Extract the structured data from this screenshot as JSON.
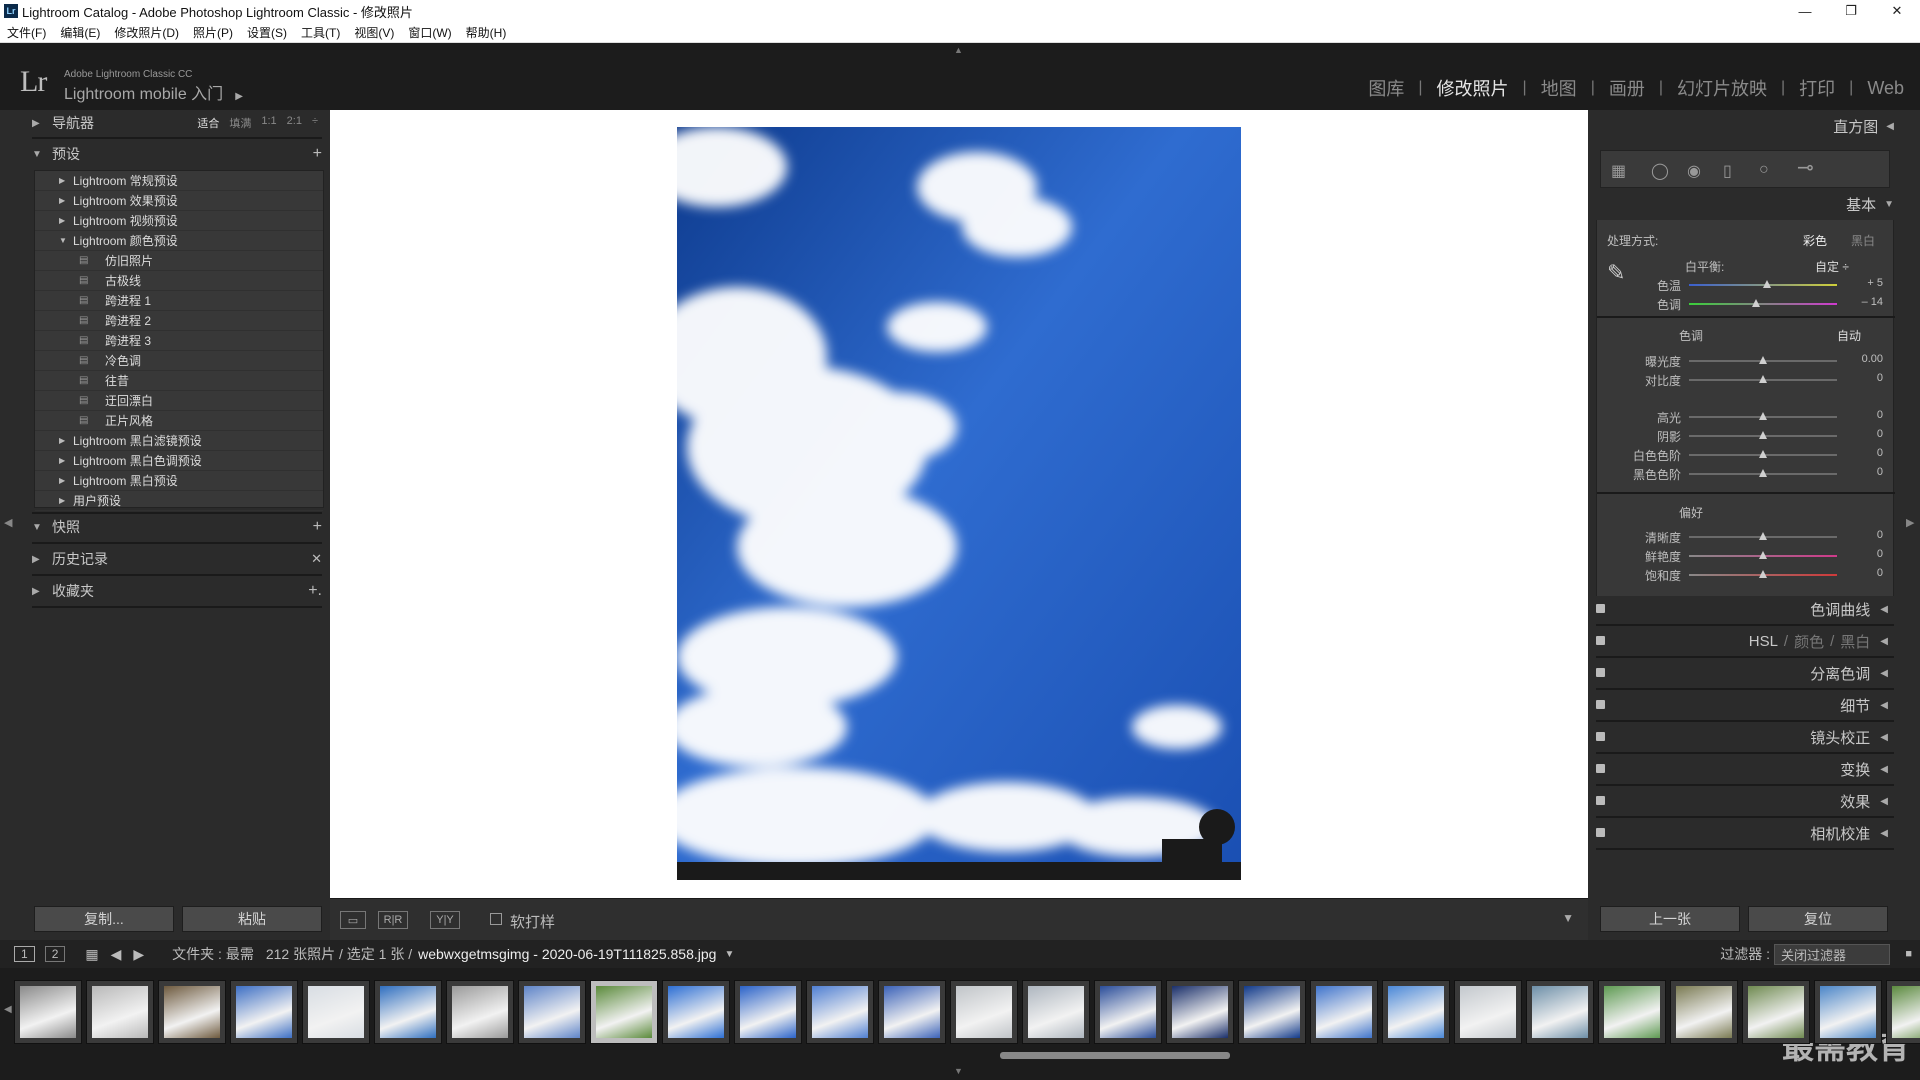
{
  "titlebar": {
    "badge": "Lr",
    "title": "Lightroom Catalog - Adobe Photoshop Lightroom Classic - 修改照片",
    "minimize": "—",
    "restore": "❐",
    "close": "✕"
  },
  "menu": [
    "文件(F)",
    "编辑(E)",
    "修改照片(D)",
    "照片(P)",
    "设置(S)",
    "工具(T)",
    "视图(V)",
    "窗口(W)",
    "帮助(H)"
  ],
  "identity": {
    "logo": "Lr",
    "small": "Adobe Lightroom Classic CC",
    "big": "Lightroom mobile 入门",
    "play": "▶"
  },
  "modules": [
    "图库",
    "修改照片",
    "地图",
    "画册",
    "幻灯片放映",
    "打印",
    "Web"
  ],
  "active_module": "修改照片",
  "left_panel": {
    "navigator": {
      "title": "导航器",
      "zoom": [
        "适合",
        "填满",
        "1:1",
        "2:1"
      ],
      "zoom_active": "适合"
    },
    "presets": {
      "title": "预设",
      "add": "+",
      "items": [
        {
          "label": "Lightroom 常规预设",
          "type": "group"
        },
        {
          "label": "Lightroom 效果预设",
          "type": "group"
        },
        {
          "label": "Lightroom 视频预设",
          "type": "group"
        },
        {
          "label": "Lightroom 颜色预设",
          "type": "open"
        },
        {
          "label": "仿旧照片",
          "type": "child"
        },
        {
          "label": "古极线",
          "type": "child"
        },
        {
          "label": "跨进程 1",
          "type": "child"
        },
        {
          "label": "跨进程 2",
          "type": "child"
        },
        {
          "label": "跨进程 3",
          "type": "child"
        },
        {
          "label": "冷色调",
          "type": "child"
        },
        {
          "label": "往昔",
          "type": "child"
        },
        {
          "label": "迂回漂白",
          "type": "child"
        },
        {
          "label": "正片风格",
          "type": "child"
        },
        {
          "label": "Lightroom 黑白滤镜预设",
          "type": "group"
        },
        {
          "label": "Lightroom 黑白色调预设",
          "type": "group"
        },
        {
          "label": "Lightroom 黑白预设",
          "type": "group"
        },
        {
          "label": "用户预设",
          "type": "group"
        }
      ]
    },
    "snapshots": {
      "title": "快照",
      "add": "+"
    },
    "history": {
      "title": "历史记录",
      "clear": "✕"
    },
    "collections": {
      "title": "收藏夹",
      "add": "+."
    },
    "copy_button": "复制...",
    "paste_button": "粘贴"
  },
  "toolbar": {
    "ab1": "R|R",
    "ab2": "Y|Y",
    "soft_proof": "软打样"
  },
  "right_panel": {
    "histogram": "直方图",
    "basic": "基本",
    "treatment_label": "处理方式:",
    "treatment_color": "彩色",
    "treatment_bw": "黑白",
    "wb_label": "白平衡:",
    "wb_value": "自定 ÷",
    "tone_label": "色调",
    "tone_auto": "自动",
    "presence_label": "偏好",
    "sliders_wb": [
      {
        "label": "色温",
        "value": "+ 5",
        "pos": 0.53
      },
      {
        "label": "色调",
        "value": "– 14",
        "pos": 0.45
      }
    ],
    "sliders_tone1": [
      {
        "label": "曝光度",
        "value": "0.00",
        "pos": 0.5
      },
      {
        "label": "对比度",
        "value": "0",
        "pos": 0.5
      }
    ],
    "sliders_tone2": [
      {
        "label": "高光",
        "value": "0",
        "pos": 0.5
      },
      {
        "label": "阴影",
        "value": "0",
        "pos": 0.5
      },
      {
        "label": "白色色阶",
        "value": "0",
        "pos": 0.5
      },
      {
        "label": "黑色色阶",
        "value": "0",
        "pos": 0.5
      }
    ],
    "sliders_presence": [
      {
        "label": "清晰度",
        "value": "0",
        "pos": 0.5
      },
      {
        "label": "鲜艳度",
        "value": "0",
        "pos": 0.5
      },
      {
        "label": "饱和度",
        "value": "0",
        "pos": 0.5
      }
    ],
    "sections": [
      "色调曲线",
      "HSL",
      "分离色调",
      "细节",
      "镜头校正",
      "变换",
      "效果",
      "相机校准"
    ],
    "hsl_extra": [
      "颜色",
      "黑白"
    ],
    "prev_button": "上一张",
    "reset_button": "复位"
  },
  "filmstrip": {
    "page1": "1",
    "page2": "2",
    "source": "文件夹 : 最需",
    "count": "212 张照片 / 选定 1 张 /",
    "filename": "webwxgetmsgimg - 2020-06-19T111825.858.jpg",
    "filter_label": "过滤器 :",
    "filter_value": "关闭过滤器",
    "watermark": "最需教育",
    "thumb_colors": [
      "#8a8a8a",
      "#b8b8b8",
      "#6e5a3e",
      "#3d6fc4",
      "#d8dde3",
      "#2f6fc0",
      "#9a9a9a",
      "#5e84c8",
      "#5a8a3a",
      "#2d6fd4",
      "#2b63c9",
      "#4f7fd2",
      "#3b62b8",
      "#c0c4c8",
      "#aeb6bf",
      "#2a4d9a",
      "#1a2f6a",
      "#123a8a",
      "#3f74cc",
      "#4a88d8",
      "#c3c8cd",
      "#6d8fa8",
      "#5e9a52",
      "#7a7a52",
      "#6f8a50",
      "#4b86c8",
      "#5b8a3e"
    ],
    "selected_index": 8
  },
  "colors": {
    "accent_sky": "#2f62c4",
    "panel_bg": "#2b2b2b"
  }
}
